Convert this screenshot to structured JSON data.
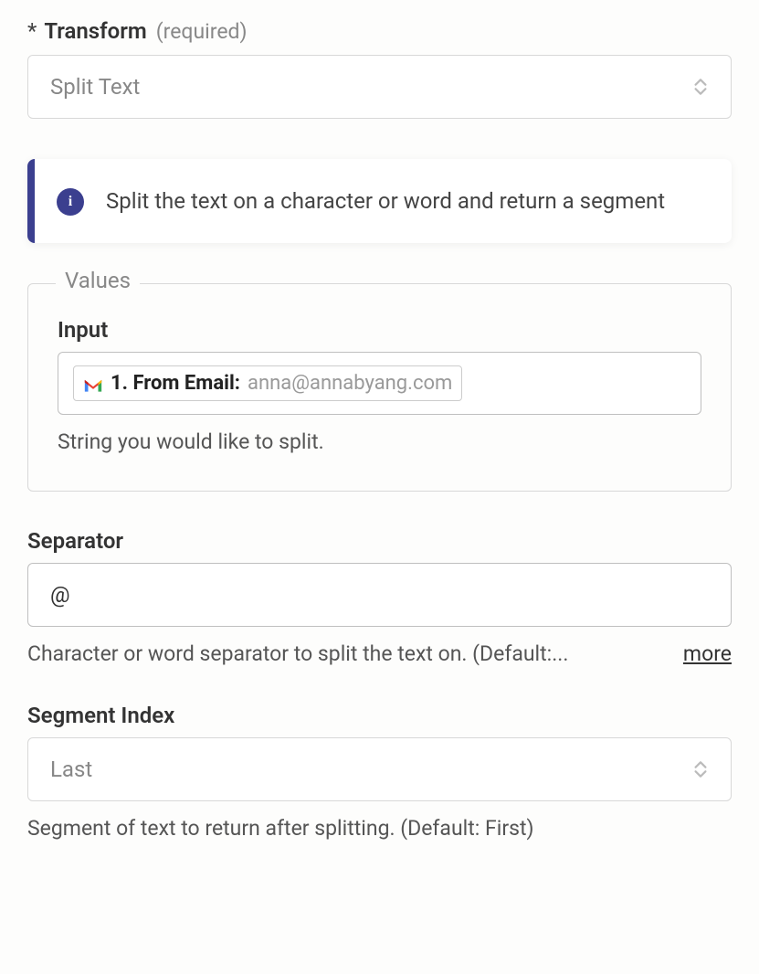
{
  "transform": {
    "asterisk": "*",
    "label": "Transform",
    "required_hint": "(required)",
    "selected": "Split Text"
  },
  "info": {
    "text": "Split the text on a character or word and return a segment"
  },
  "values": {
    "legend": "Values",
    "input": {
      "label": "Input",
      "pill_icon": "gmail",
      "pill_label": "1. From Email:",
      "pill_value": "anna@annabyang.com",
      "help": "String you would like to split."
    }
  },
  "separator": {
    "label": "Separator",
    "value": "@",
    "help": "Character or word separator to split the text on. (Default:...",
    "more": "more"
  },
  "segment_index": {
    "label": "Segment Index",
    "selected": "Last",
    "help": "Segment of text to return after splitting. (Default: First)"
  }
}
